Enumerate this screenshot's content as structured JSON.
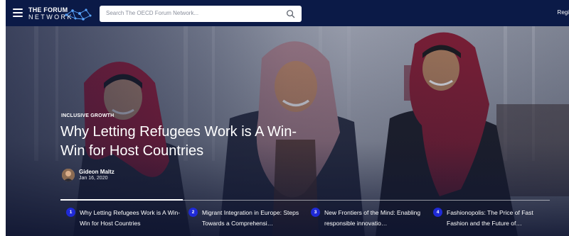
{
  "header": {
    "logo_line1": "THE FORUM",
    "logo_line2": "NETWORK",
    "search_placeholder": "Search The OECD Forum Network...",
    "register_label": "Regis"
  },
  "hero": {
    "category": "INCLUSIVE GROWTH",
    "title": "Why Letting Refugees Work is A Win-Win for Host Countries",
    "author_name": "Gideon Maltz",
    "date": "Jan 16, 2020"
  },
  "stories": [
    {
      "number": "1",
      "title": "Why Letting Refugees Work is A Win-Win for Host Countries"
    },
    {
      "number": "2",
      "title": "Migrant Integration in Europe: Steps Towards a Comprehensi…"
    },
    {
      "number": "3",
      "title": "New Frontiers of the Mind: Enabling responsible innovatio…"
    },
    {
      "number": "4",
      "title": "Fashionopolis: The Price of Fast Fashion and the Future of…"
    }
  ],
  "colors": {
    "header_bg": "#0b1a47",
    "number_badge": "#1f2ad6",
    "headscarf_red": "#b21f3a",
    "headscarf_mauve": "#b58a93"
  },
  "icons": [
    "menu-icon",
    "network-logo-icon",
    "search-icon"
  ]
}
